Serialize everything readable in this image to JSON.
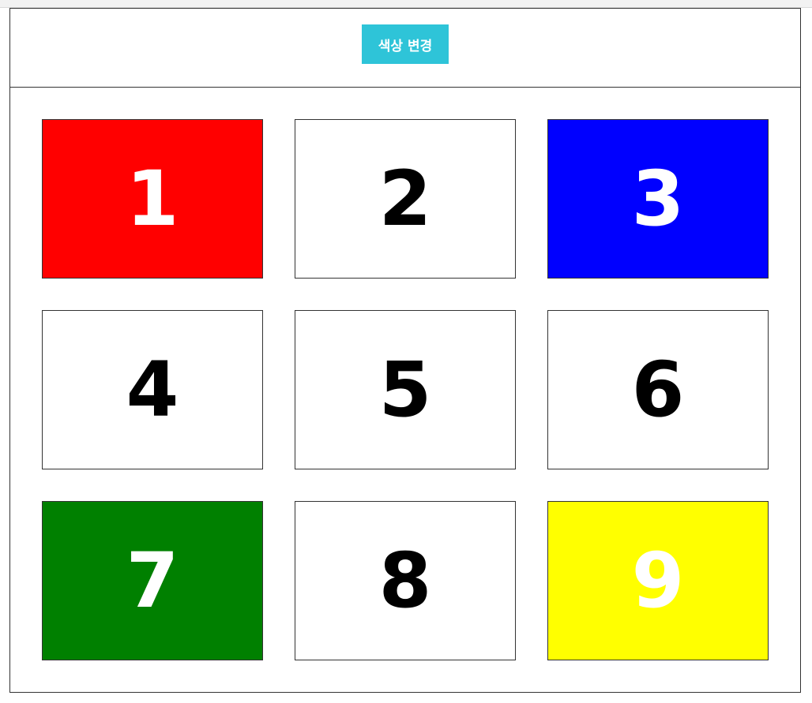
{
  "header": {
    "button_label": "색상 변경",
    "button_color": "#2ec4d8"
  },
  "cells": [
    {
      "label": "1",
      "bg": "#ff0000",
      "fg": "#ffffff"
    },
    {
      "label": "2",
      "bg": "#ffffff",
      "fg": "#000000"
    },
    {
      "label": "3",
      "bg": "#0000ff",
      "fg": "#ffffff"
    },
    {
      "label": "4",
      "bg": "#ffffff",
      "fg": "#000000"
    },
    {
      "label": "5",
      "bg": "#ffffff",
      "fg": "#000000"
    },
    {
      "label": "6",
      "bg": "#ffffff",
      "fg": "#000000"
    },
    {
      "label": "7",
      "bg": "#008000",
      "fg": "#ffffff"
    },
    {
      "label": "8",
      "bg": "#ffffff",
      "fg": "#000000"
    },
    {
      "label": "9",
      "bg": "#ffff00",
      "fg": "#ffffff"
    }
  ]
}
